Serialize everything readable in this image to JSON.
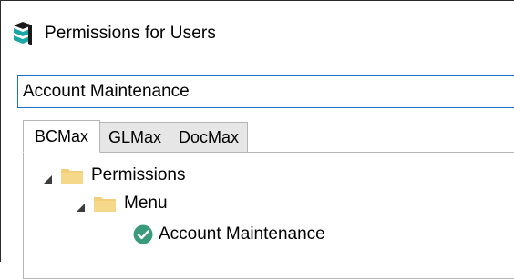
{
  "window": {
    "title": "Permissions for Users",
    "app_icon": "stack-icon"
  },
  "combo": {
    "value": "Account Maintenance"
  },
  "tabs": [
    {
      "label": "BCMax",
      "active": true
    },
    {
      "label": "GLMax",
      "active": false
    },
    {
      "label": "DocMax",
      "active": false
    }
  ],
  "tree": {
    "root": {
      "label": "Permissions",
      "icon": "folder-icon",
      "expanded": true
    },
    "child": {
      "label": "Menu",
      "icon": "folder-icon",
      "expanded": true
    },
    "leaf": {
      "label": "Account Maintenance",
      "icon": "check-circle-icon"
    }
  },
  "colors": {
    "accent_border": "#1a73c8",
    "folder": "#f2cf7a",
    "check": "#3a9a7b",
    "icon_teal": "#1ba7a6"
  }
}
